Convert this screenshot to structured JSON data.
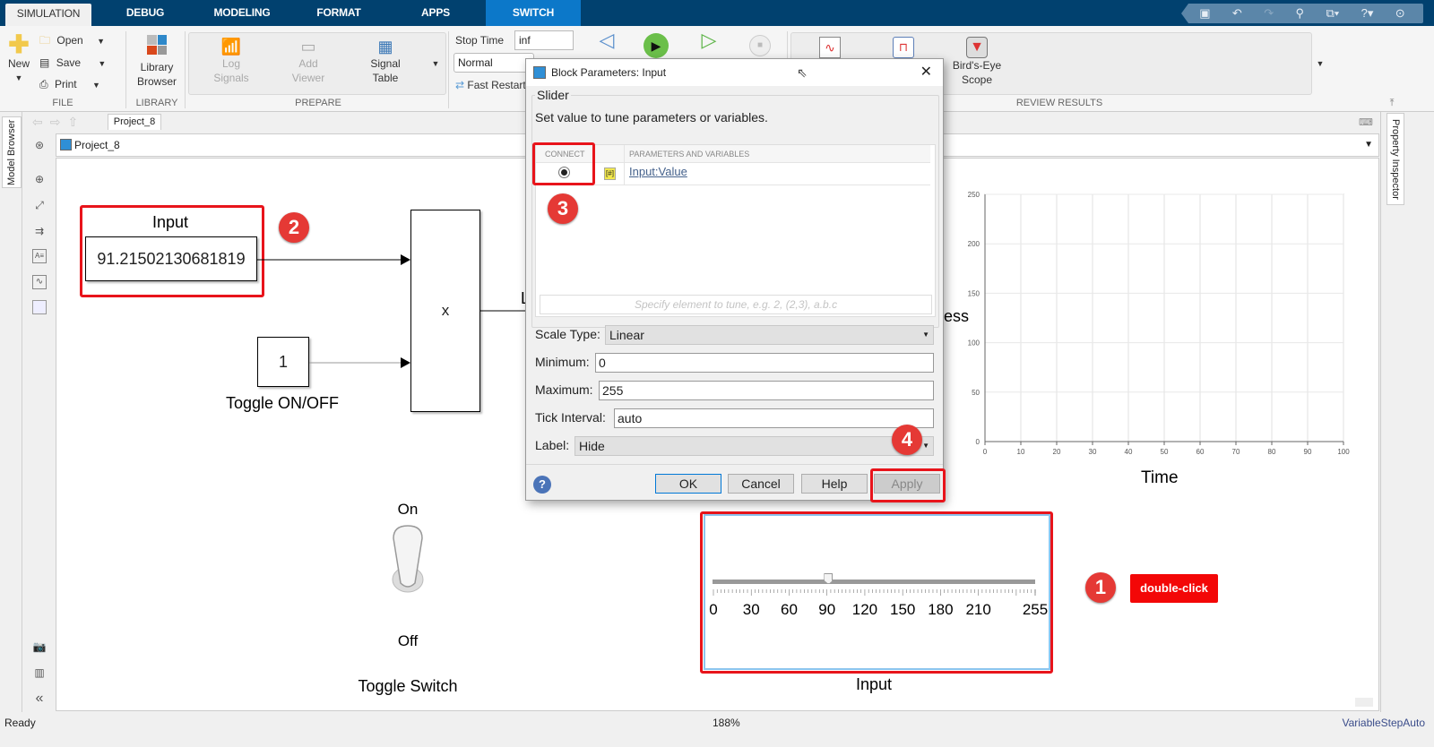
{
  "tabs": [
    {
      "label": "SIMULATION",
      "active": true
    },
    {
      "label": "DEBUG"
    },
    {
      "label": "MODELING"
    },
    {
      "label": "FORMAT"
    },
    {
      "label": "APPS"
    },
    {
      "label": "SWITCH",
      "contextual": true
    }
  ],
  "quick_access": [
    "save-icon",
    "undo-icon",
    "redo-icon",
    "search-icon",
    "shortcut-icon",
    "help-icon",
    "collapse-icon"
  ],
  "ribbon": {
    "file": {
      "new": "New",
      "open": "Open",
      "save": "Save",
      "print": "Print",
      "group": "FILE"
    },
    "library": {
      "browser_line1": "Library",
      "browser_line2": "Browser",
      "group": "LIBRARY"
    },
    "prepare": {
      "log_line1": "Log",
      "log_line2": "Signals",
      "viewer_line1": "Add",
      "viewer_line2": "Viewer",
      "table_line1": "Signal",
      "table_line2": "Table",
      "group": "PREPARE"
    },
    "simulate": {
      "stop_time_label": "Stop Time",
      "stop_time_value": "inf",
      "mode": "Normal",
      "fast_restart": "Fast Restart"
    },
    "review": {
      "birds_eye_line1": "Bird's-Eye",
      "birds_eye_line2": "Scope",
      "group": "REVIEW RESULTS"
    }
  },
  "side_tabs": {
    "model_browser": "Model Browser",
    "property_inspector": "Property Inspector"
  },
  "breadcrumb": {
    "tab": "Project_8",
    "path": "Project_8"
  },
  "canvas": {
    "input_block": {
      "title": "Input",
      "value": "91.21502130681819"
    },
    "constant_block": {
      "value": "1",
      "label": "Toggle ON/OFF"
    },
    "product_block": {
      "symbol": "x"
    },
    "partial_label": "ess",
    "partial_L": "L",
    "toggle": {
      "on": "On",
      "off": "Off",
      "label": "Toggle Switch",
      "state": "On"
    },
    "slider": {
      "label": "Input",
      "min": 0,
      "max": 255,
      "value": 91.21502130681819,
      "tick_labels": [
        "0",
        "30",
        "60",
        "90",
        "120",
        "150",
        "180",
        "210",
        "255"
      ]
    },
    "annotations": [
      {
        "number": "1",
        "text": "double-click"
      },
      {
        "number": "2"
      },
      {
        "number": "3"
      },
      {
        "number": "4"
      }
    ]
  },
  "chart_data": {
    "type": "line",
    "title": "",
    "xlabel": "Time",
    "ylabel": "",
    "xlim": [
      0,
      100
    ],
    "ylim": [
      0,
      250
    ],
    "xticks": [
      "0",
      "10",
      "20",
      "30",
      "40",
      "50",
      "60",
      "70",
      "80",
      "90",
      "100"
    ],
    "yticks": [
      "0",
      "50",
      "100",
      "150",
      "200",
      "250"
    ],
    "grid": true,
    "series": []
  },
  "dialog": {
    "title": "Block Parameters: Input",
    "group": "Slider",
    "description": "Set value to tune parameters or variables.",
    "col_connect": "CONNECT",
    "col_params": "PARAMETERS AND VARIABLES",
    "param_link": "Input:Value",
    "element_placeholder": "Specify element to tune, e.g. 2, (2,3), a.b.c",
    "scale_type_label": "Scale Type:",
    "scale_type_value": "Linear",
    "minimum_label": "Minimum:",
    "minimum_value": "0",
    "maximum_label": "Maximum:",
    "maximum_value": "255",
    "tick_label": "Tick Interval:",
    "tick_value": "auto",
    "label_label": "Label:",
    "label_value": "Hide",
    "buttons": {
      "ok": "OK",
      "cancel": "Cancel",
      "help": "Help",
      "apply": "Apply"
    }
  },
  "status": {
    "left": "Ready",
    "zoom": "188%",
    "solver": "VariableStepAuto"
  }
}
